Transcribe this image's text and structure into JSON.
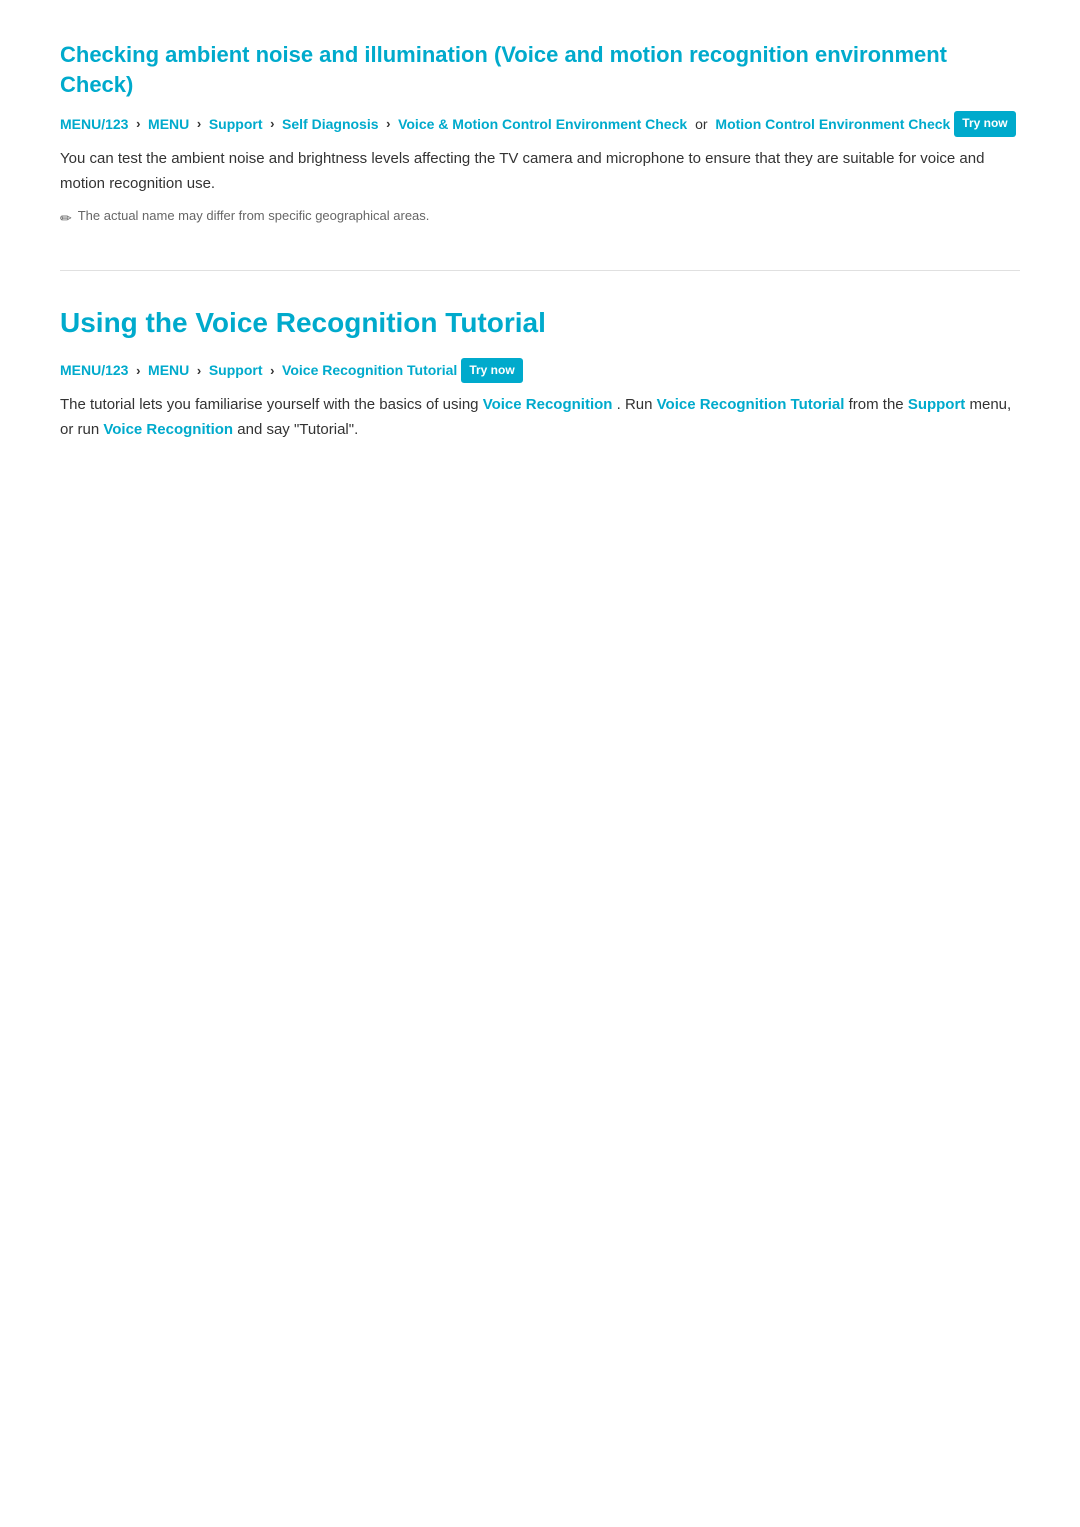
{
  "section1": {
    "title": "Checking ambient noise and illumination (Voice and motion recognition environment Check)",
    "breadcrumb": {
      "items": [
        {
          "label": "MENU/123",
          "separator": "›"
        },
        {
          "label": "MENU",
          "separator": "›"
        },
        {
          "label": "Support",
          "separator": "›"
        },
        {
          "label": "Self Diagnosis",
          "separator": "›"
        },
        {
          "label": "Voice & Motion Control Environment Check",
          "separator": ""
        }
      ],
      "or_text": "or",
      "extra_link": "Motion Control Environment Check",
      "try_now_badge": "Try now"
    },
    "body": "You can test the ambient noise and brightness levels affecting the TV camera and microphone to ensure that they are suitable for voice and motion recognition use.",
    "note": "The actual name may differ from specific geographical areas."
  },
  "section2": {
    "title": "Using the Voice Recognition Tutorial",
    "breadcrumb": {
      "items": [
        {
          "label": "MENU/123",
          "separator": "›"
        },
        {
          "label": "MENU",
          "separator": "›"
        },
        {
          "label": "Support",
          "separator": "›"
        },
        {
          "label": "Voice Recognition Tutorial",
          "separator": ""
        }
      ],
      "try_now_badge": "Try now"
    },
    "body_part1": "The tutorial lets you familiarise yourself with the basics of using",
    "link1": "Voice Recognition",
    "body_part2": ". Run",
    "link2": "Voice Recognition Tutorial",
    "body_part3": "from the",
    "link3": "Support",
    "body_part4": "menu, or run",
    "link4": "Voice Recognition",
    "body_part5": "and say \"Tutorial\"."
  },
  "icons": {
    "pencil": "✏",
    "chevron": "›"
  }
}
